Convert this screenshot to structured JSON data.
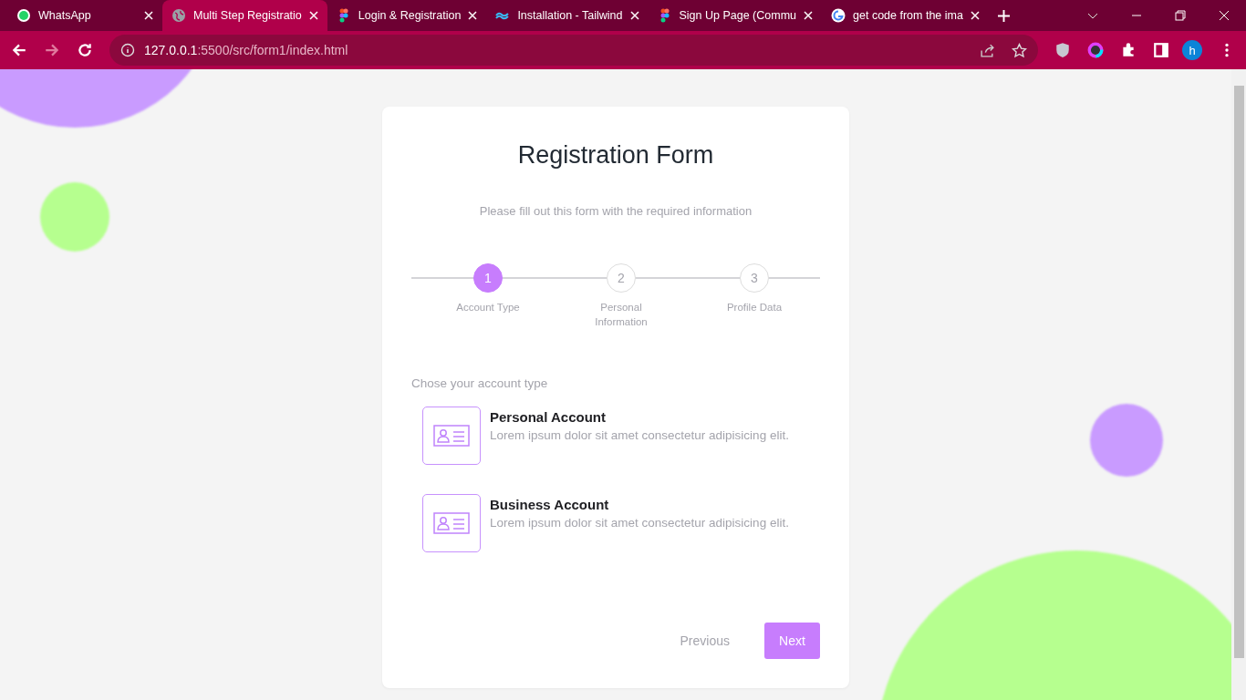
{
  "tabs": [
    {
      "kind": "whatsapp",
      "title": "WhatsApp",
      "selected": false
    },
    {
      "kind": "globe",
      "title": "Multi Step Registratio",
      "selected": true
    },
    {
      "kind": "figma",
      "title": "Login & Registration",
      "selected": false
    },
    {
      "kind": "tailwind",
      "title": "Installation - Tailwind",
      "selected": false
    },
    {
      "kind": "figma",
      "title": "Sign Up Page (Commu",
      "selected": false
    },
    {
      "kind": "google",
      "title": "get code from the ima",
      "selected": false
    }
  ],
  "address": {
    "host": "127.0.0.1",
    "path": ":5500/src/form1/index.html"
  },
  "profile_initial": "h",
  "form": {
    "title": "Registration Form",
    "subtitle": "Please fill out this form with the required information",
    "steps": [
      {
        "number": "1",
        "label": "Account Type",
        "selected": true
      },
      {
        "number": "2",
        "label": "Personal Information",
        "selected": false
      },
      {
        "number": "3",
        "label": "Profile Data",
        "selected": false
      }
    ],
    "prompt": "Chose your account type",
    "options": [
      {
        "title": "Personal Account",
        "description": "Lorem ipsum dolor sit amet consectetur adipisicing elit."
      },
      {
        "title": "Business Account",
        "description": "Lorem ipsum dolor sit amet consectetur adipisicing elit."
      }
    ],
    "previous": "Previous",
    "next": "Next"
  }
}
